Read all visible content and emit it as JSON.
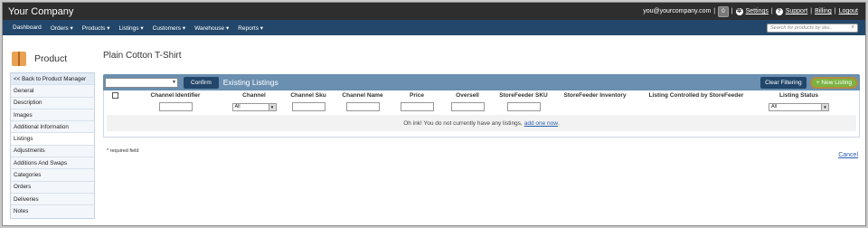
{
  "app": {
    "brand": "Your Company"
  },
  "user": {
    "email": "you@yourcompany.com",
    "badge_count": "0",
    "settings": "Settings",
    "support": "Support",
    "billing": "Billing",
    "logout": "Logout"
  },
  "nav": {
    "items": [
      {
        "label": "Dashboard",
        "caret": ""
      },
      {
        "label": "Orders",
        "caret": "▾"
      },
      {
        "label": "Products",
        "caret": "▾"
      },
      {
        "label": "Listings",
        "caret": "▾"
      },
      {
        "label": "Customers",
        "caret": "▾"
      },
      {
        "label": "Warehouse",
        "caret": "▾"
      },
      {
        "label": "Reports",
        "caret": "▾"
      }
    ],
    "search_placeholder": "Search for products by sku..",
    "search_icon": "search-icon"
  },
  "sidebar": {
    "title": "Product",
    "icon": "product-box-icon",
    "items": [
      "<< Back to Product Manager",
      "General",
      "Description",
      "Images",
      "Additional Information",
      "Listings",
      "Adjustments",
      "Additions And Swaps",
      "Categories",
      "Orders",
      "Deliveries",
      "Notes"
    ],
    "active": "Listings"
  },
  "main": {
    "title": "Plain Cotton T-Shirt",
    "toolbar": {
      "confirm": "Confirm",
      "title": "Existing Listings",
      "clear_filtering": "Clear Filtering",
      "new_listing": "New Listing",
      "new_listing_icon": "plus-icon"
    },
    "columns": [
      "Channel Identifier",
      "Channel",
      "Channel Sku",
      "Channel Name",
      "Price",
      "Oversell",
      "StoreFeeder SKU",
      "StoreFeeder Inventory",
      "Listing Controlled by StoreFeeder",
      "Listing Status"
    ],
    "filters": {
      "channel_value": "All",
      "status_value": "All"
    },
    "empty_message": "Oh ink! You do not currently have any listings,",
    "empty_link": "add one now",
    "empty_suffix": ".",
    "required_note": "* required field",
    "cancel": "Cancel"
  },
  "colors": {
    "topbar": "#2e2e2e",
    "navbar": "#23476a",
    "toolbar": "#6a8fb0",
    "new_button": "#7bb343",
    "link": "#2a5db0"
  }
}
